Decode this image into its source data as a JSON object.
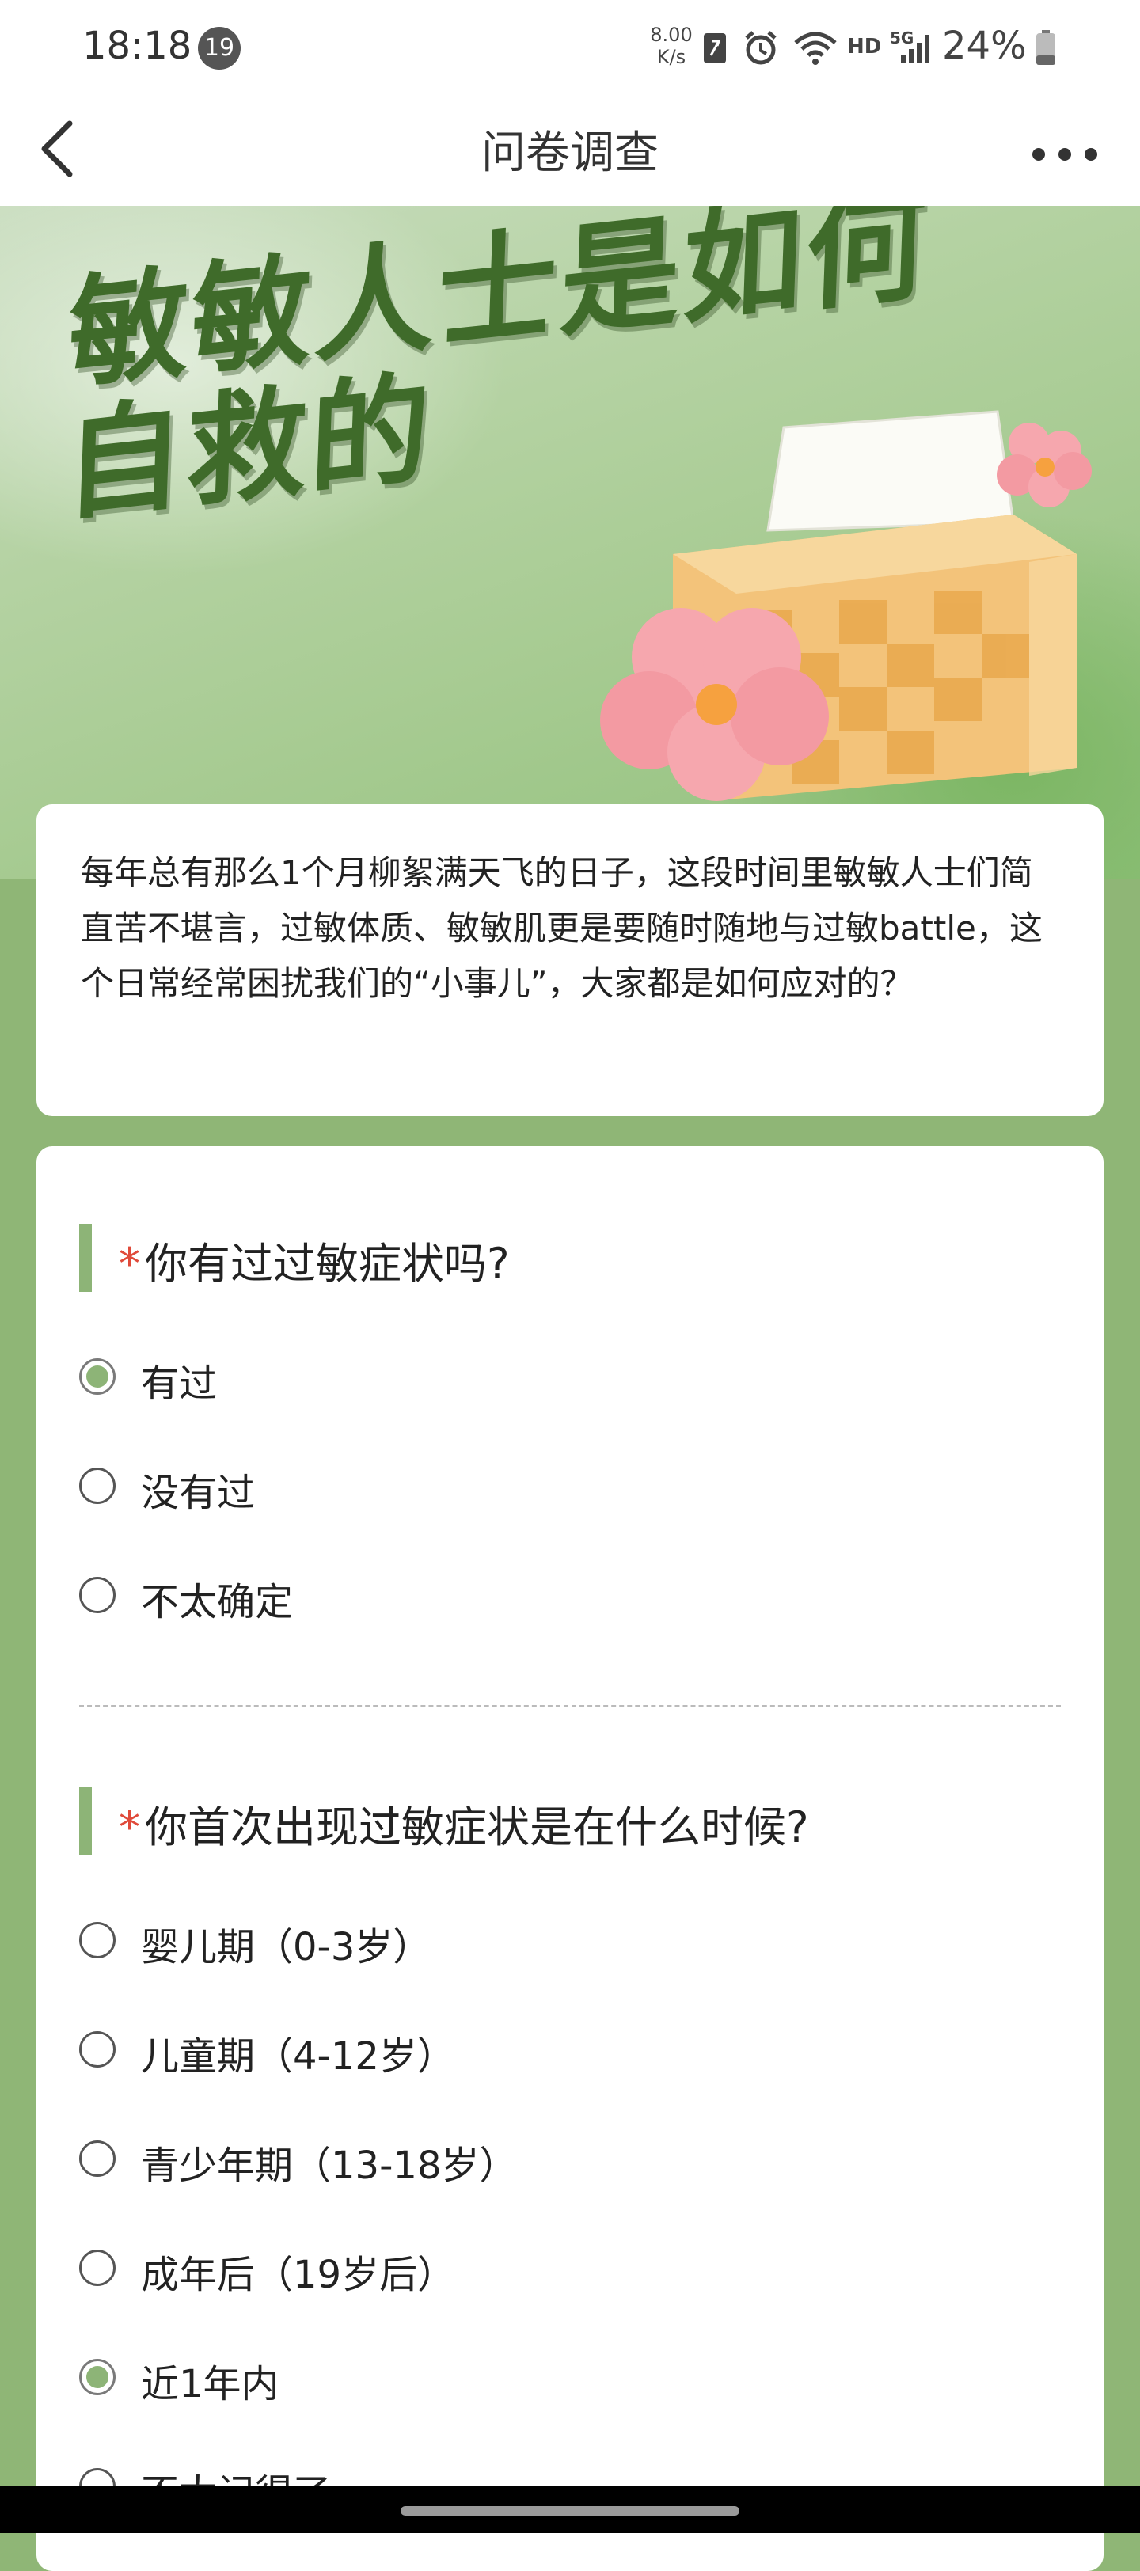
{
  "status_bar": {
    "time": "18:18",
    "notification_count": "19",
    "net_speed_value": "8.00",
    "net_speed_unit": "K/s",
    "hd_label": "HD",
    "signal_label": "5G",
    "battery": "24%"
  },
  "header": {
    "title": "问卷调查",
    "back_icon": "chevron-left-icon",
    "more_icon": "more-dots-icon"
  },
  "banner": {
    "line1": "敏敏人士是如何",
    "line2": "自救的"
  },
  "intro": {
    "text": "每年总有那么1个月柳絮满天飞的日子，这段时间里敏敏人士们简直苦不堪言，过敏体质、敏敏肌更是要随时随地与过敏battle，这个日常经常困扰我们的“小事儿”，大家都是如何应对的？"
  },
  "questions": [
    {
      "required_mark": "*",
      "title": "你有过过敏症状吗?",
      "options": [
        {
          "label": "有过",
          "checked": true
        },
        {
          "label": "没有过",
          "checked": false
        },
        {
          "label": "不太确定",
          "checked": false
        }
      ]
    },
    {
      "required_mark": "*",
      "title": "你首次出现过敏症状是在什么时候?",
      "options": [
        {
          "label": "婴儿期（0-3岁）",
          "checked": false
        },
        {
          "label": "儿童期（4-12岁）",
          "checked": false
        },
        {
          "label": "青少年期（13-18岁）",
          "checked": false
        },
        {
          "label": "成年后（19岁后）",
          "checked": false
        },
        {
          "label": "近1年内",
          "checked": true
        },
        {
          "label": "不太记得了",
          "checked": false
        }
      ]
    }
  ],
  "colors": {
    "accent_green": "#8db477",
    "page_background": "#8fb676",
    "banner_title": "#3f6b2a",
    "required_red": "#e04a3a"
  }
}
